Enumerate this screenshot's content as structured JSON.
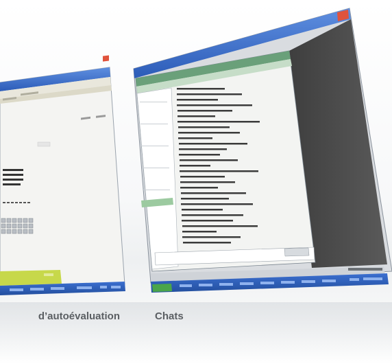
{
  "captions": {
    "left": "d’autoévaluation",
    "right": "Chats"
  },
  "colors": {
    "titlebar": "#3a6fc9",
    "taskbar": "#2f5fb8",
    "green_bar": "#c7d84a",
    "chat_header": "#6aa07a",
    "dark_panel": "#4a4a4a",
    "close_button": "#e0533c"
  },
  "icons": [
    "close-icon",
    "start-button-icon",
    "taskbar-icon"
  ]
}
